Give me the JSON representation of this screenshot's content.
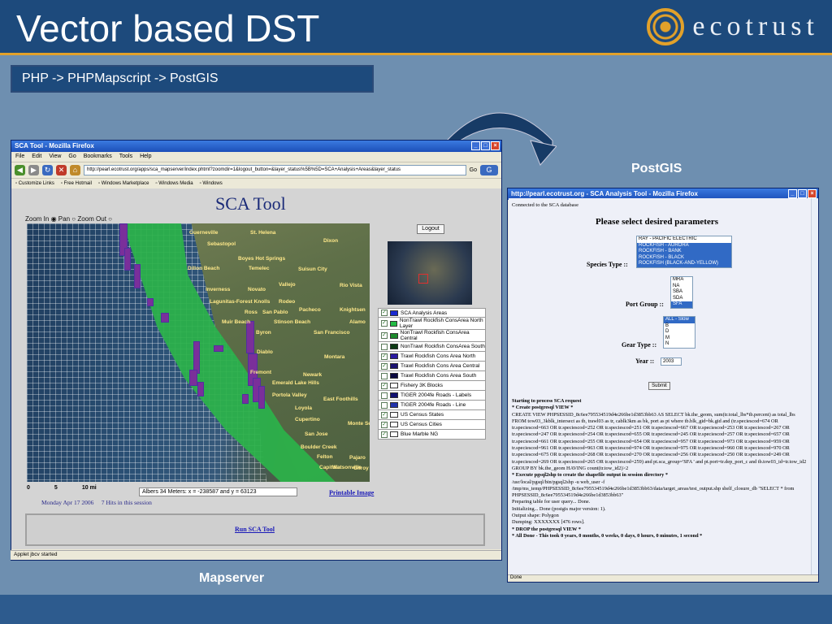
{
  "slide": {
    "title": "Vector based DST",
    "subtitle": "PHP -> PHPMapscript -> PostGIS",
    "logo_text": "ecotrust",
    "label_postgis": "PostGIS",
    "label_mapserver": "Mapserver"
  },
  "left_window": {
    "title": "SCA Tool - Mozilla Firefox",
    "menu": [
      "File",
      "Edit",
      "View",
      "Go",
      "Bookmarks",
      "Tools",
      "Help"
    ],
    "url": "http://pearl.ecotrust.org/apps/sca_mapserver/index.phtml?zoomdir=1&logout_button=&layer_status%5B%5D=SCA+Analysis+Areas&layer_status",
    "go_label": "Go",
    "bookmarks": [
      "Customize Links",
      "Free Hotmail",
      "Windows Marketplace",
      "Windows Media",
      "Windows"
    ],
    "page_title": "SCA Tool",
    "zoom": {
      "zoom_in": "Zoom In",
      "pan": "Pan",
      "zoom_out": "Zoom Out"
    },
    "logout": "Logout",
    "layers": [
      {
        "label": "SCA Analysis Areas",
        "checked": true,
        "color": "#1a2ad0"
      },
      {
        "label": "NonTrawl Rockfish ConsArea North Layer",
        "checked": true,
        "color": "#22bb44"
      },
      {
        "label": "NonTrawl Rockfish ConsArea Central",
        "checked": true,
        "color": "#1c8a2c"
      },
      {
        "label": "NonTrawl Rockfish ConsArea South",
        "checked": false,
        "color": "#0c3a14"
      },
      {
        "label": "Trawl Rockfish Cons Area North",
        "checked": true,
        "color": "#2a1aa0"
      },
      {
        "label": "Trawl Rockfish Cons Area Central",
        "checked": true,
        "color": "#1a1270"
      },
      {
        "label": "Trawl Rockfish Cons Area South",
        "checked": false,
        "color": "#0a0840"
      },
      {
        "label": "Fishery 3K Blocks",
        "checked": true,
        "color": "#ffffff"
      },
      {
        "label": "TIGER 2004fe Roads - Labels",
        "checked": false,
        "color": "#101070"
      },
      {
        "label": "TIGER 2004fe Roads - Line",
        "checked": false,
        "color": "#2233aa"
      },
      {
        "label": "US Census States",
        "checked": true,
        "color": "#ffffff"
      },
      {
        "label": "US Census Cities",
        "checked": true,
        "color": "#ffffff"
      },
      {
        "label": "Blue Marble NG",
        "checked": true,
        "color": "#ffffff"
      }
    ],
    "scale": {
      "zero": "0",
      "five": "5",
      "ten": "10",
      "unit": "mi"
    },
    "coords": "Albers 34 Meters:  x = -238587  and  y = 63123",
    "printable": "Printable Image",
    "date": "Monday Apr 17 2006",
    "hits": "7 Hits in this session",
    "run": "Run SCA Tool",
    "status": "Applet jbcv started",
    "cities": [
      "Guerneville",
      "St. Helena",
      "Sebastopol",
      "Dixon",
      "Boyes Hot Springs",
      "Dillon Beach",
      "Temelec",
      "Suisun City",
      "Vallejo",
      "Rio Vista",
      "Inverness",
      "Novato",
      "Lagunitas-Forest Knolls",
      "Rodeo",
      "Pacheco",
      "Knightsen",
      "Ross",
      "San Pablo",
      "Muir Beach",
      "Stinson Beach",
      "Alamo",
      "Byron",
      "San Francisco",
      "Diablo",
      "Montara",
      "Fremont",
      "Newark",
      "Emerald Lake Hills",
      "Portola Valley",
      "East Foothills",
      "Loyola",
      "Cupertino",
      "Monte Sereno",
      "San Jose",
      "Boulder Creek",
      "Felton",
      "Capitola",
      "Watsonville",
      "Pajaro",
      "Gilroy"
    ]
  },
  "right_window": {
    "title": "http://pearl.ecotrust.org - SCA Analysis Tool - Mozilla Firefox",
    "connected": "Connected to the SCA database",
    "heading": "Please select desired parameters",
    "species_label": "Species Type ::",
    "species": [
      {
        "t": "RAY - PACIFIC ELECTRIC",
        "on": false
      },
      {
        "t": "ROCKFISH - AURORA",
        "on": true
      },
      {
        "t": "ROCKFISH - BANK",
        "on": true
      },
      {
        "t": "ROCKFISH - BLACK",
        "on": true
      },
      {
        "t": "ROCKFISH (BLACK-AND-YELLOW)",
        "on": true
      }
    ],
    "port_label": "Port Group ::",
    "ports": [
      {
        "t": "MRA",
        "on": false
      },
      {
        "t": "NA",
        "on": false
      },
      {
        "t": "SBA",
        "on": false
      },
      {
        "t": "SDA",
        "on": false
      },
      {
        "t": "SFA",
        "on": true
      }
    ],
    "gear_label": "Gear Type ::",
    "gears": [
      {
        "t": "ALL - Slow",
        "on": true
      },
      {
        "t": "B",
        "on": false
      },
      {
        "t": "D",
        "on": false
      },
      {
        "t": "M",
        "on": false
      },
      {
        "t": "N",
        "on": false
      }
    ],
    "year_label": "Year ::",
    "year": "2003",
    "submit": "Submit",
    "log": [
      {
        "t": "Starting to process SCA request",
        "b": true
      },
      {
        "t": "* Create postgresql VIEW *",
        "b": true
      },
      {
        "t": "CREATE VIEW PHPSESSID_8c6ee795534519d4e266be1d3853bb63 AS SELECT bk.the_geom, sum(tr.total_lbs*tb.percent) as total_lbs FROM tow03_3kblk_intersect as tb, trawl03 as tr, cablk3km as bk, port as pt where tb.blk_gid=bk.gid and (tr.speciescod=674 OR tr.speciescod=663 OR tr.speciescod=252 OR tr.speciescod=251 OR tr.speciescod=667 OR tr.speciescod=253 OR tr.speciescod=267 OR tr.speciescod=247 OR tr.speciescod=254 OR tr.speciescod=655 OR tr.speciescod=245 OR tr.speciescod=257 OR tr.speciescod=657 OR tr.speciescod=661 OR tr.speciescod=255 OR tr.speciescod=654 OR tr.speciescod=957 OR tr.speciescod=973 OR tr.speciescod=959 OR tr.speciescod=961 OR tr.speciescod=963 OR tr.speciescod=974 OR tr.speciescod=975 OR tr.speciescod=960 OR tr.speciescod=970 OR tr.speciescod=675 OR tr.speciescod=268 OR tr.speciescod=270 OR tr.speciescod=256 OR tr.speciescod=250 OR tr.speciescod=249 OR tr.speciescod=269 OR tr.speciescod=265 OR tr.speciescod=259) and pt.sca_group='SFA ' and pt.port=tr.dep_port_c and tb.tow03_id=tr.tow_id2 GROUP BY bk.the_geom HAVING count(tr.tow_id2)>2",
        "b": false
      },
      {
        "t": "* Execute pgsql2shp to create the shapefile output in session directory *",
        "b": true
      },
      {
        "t": "/usr/local/pgsql/bin/pgsql2shp -u web_user -f /tmp/ms_temp/PHPSESSID_8c6ee795534519d4e266be1d3853bb63/data/target_areas/test_output.shp shelf_closure_db \"SELECT * from PHPSESSID_8c6ee795534519d4e266be1d3853bb63\"",
        "b": false
      },
      {
        "t": "Preparing table for user query... Done.",
        "b": false
      },
      {
        "t": "Initializing... Done (postgis major version: 1).",
        "b": false
      },
      {
        "t": "Output shape: Polygon",
        "b": false
      },
      {
        "t": "Dumping: XXXXXXX [476 rows].",
        "b": false
      },
      {
        "t": "* DROP the postgresql VIEW *",
        "b": true
      },
      {
        "t": "* All Done - This took 0 years, 0 months, 0 weeks, 0 days, 0 hours, 0 minutes, 1 second *",
        "b": true
      }
    ],
    "status": "Done"
  }
}
